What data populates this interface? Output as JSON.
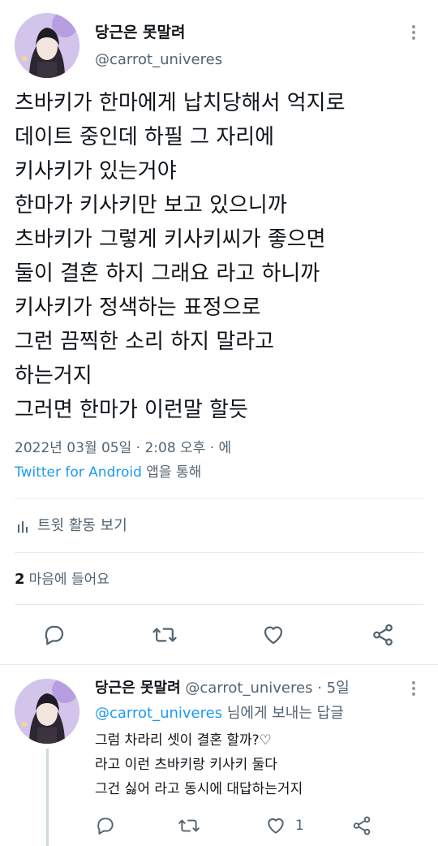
{
  "main_tweet": {
    "author": {
      "name": "당근은 못말려",
      "handle": "@carrot_univeres"
    },
    "lines": [
      "츠바키가 한마에게 납치당해서 억지로",
      "데이트 중인데 하필 그 자리에",
      "키사키가 있는거야",
      "한마가 키사키만 보고 있으니까",
      "츠바키가 그렇게 키사키씨가 좋으면",
      "둘이 결혼 하지 그래요 라고 하니까",
      "키사키가 정색하는 표정으로",
      "그런 끔찍한 소리 하지 말라고",
      "하는거지",
      "그러면 한마가 이런말 할듯"
    ],
    "timestamp": "2022년 03월 05일 · 2:08 오후 · 에",
    "source_app": "Twitter for Android",
    "source_suffix": "앱을 통해",
    "activity_label": "트윗 활동 보기",
    "likes_count": "2",
    "likes_label": "마음에 들어요"
  },
  "reply_tweet": {
    "author": {
      "name": "당근은 못말려",
      "handle": "@carrot_univeres",
      "age": "· 5일"
    },
    "reply_to_handle": "@carrot_univeres",
    "reply_to_suffix": "님에게 보내는 답글",
    "lines": [
      "그럼 차라리 셋이 결혼 할까?♡",
      "라고 이런 츠바키랑 키사키 둘다",
      "그건 싫어 라고 동시에 대답하는거지"
    ],
    "like_count": "1"
  },
  "icons": [
    "more-icon",
    "reply-icon",
    "retweet-icon",
    "like-icon",
    "share-icon",
    "activity-chart-icon"
  ],
  "colors": {
    "link": "#1d9bf0",
    "muted": "#536471",
    "divider": "#e6ebee",
    "icon": "#536471"
  }
}
